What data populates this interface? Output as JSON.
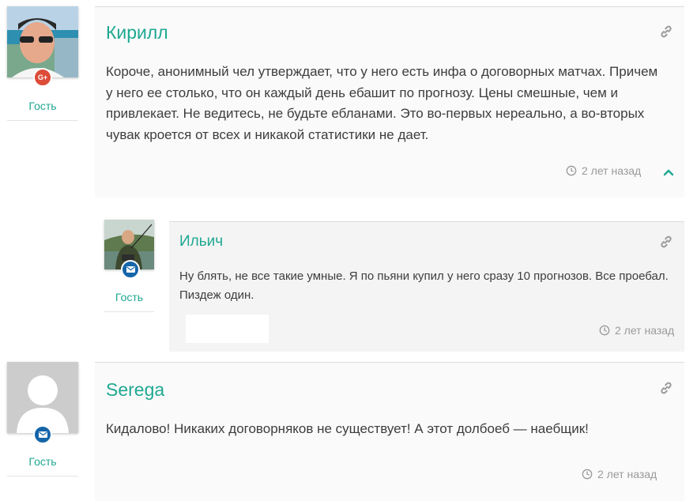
{
  "comments": [
    {
      "author": "Кирилл",
      "role": "Гость",
      "badge": "google-plus",
      "badge_text": "G+",
      "badge_color": "#dd4b39",
      "text": "Короче, анонимный чел утверждает, что у него есть инфа о договорных матчах. Причем у него ее столько, что он каждый день ебашит по прогнозу. Цены смешные, чем и привлекает. Не ведитесь, не будьте ебланами. Это во-первых нереально, а во-вторых чувак кроется от всех и никакой статистики не дает.",
      "time": "2 лет назад",
      "reply": {
        "author": "Ильич",
        "role": "Гость",
        "badge": "email",
        "badge_color": "#1565a9",
        "text": "Ну блять, не все такие умные. Я по пьяни купил у него сразу 10 прогнозов. Все проебал. Пиздеж один.",
        "time": "2 лет назад"
      }
    },
    {
      "author": "Serega",
      "role": "Гость",
      "badge": "email",
      "badge_color": "#1565a9",
      "text": "Кидалово! Никаких договорняков не существует! А этот долбоеб — наебщик!",
      "time": "2 лет назад"
    }
  ],
  "colors": {
    "accent": "#1fa892",
    "muted": "#9a9a9a"
  }
}
